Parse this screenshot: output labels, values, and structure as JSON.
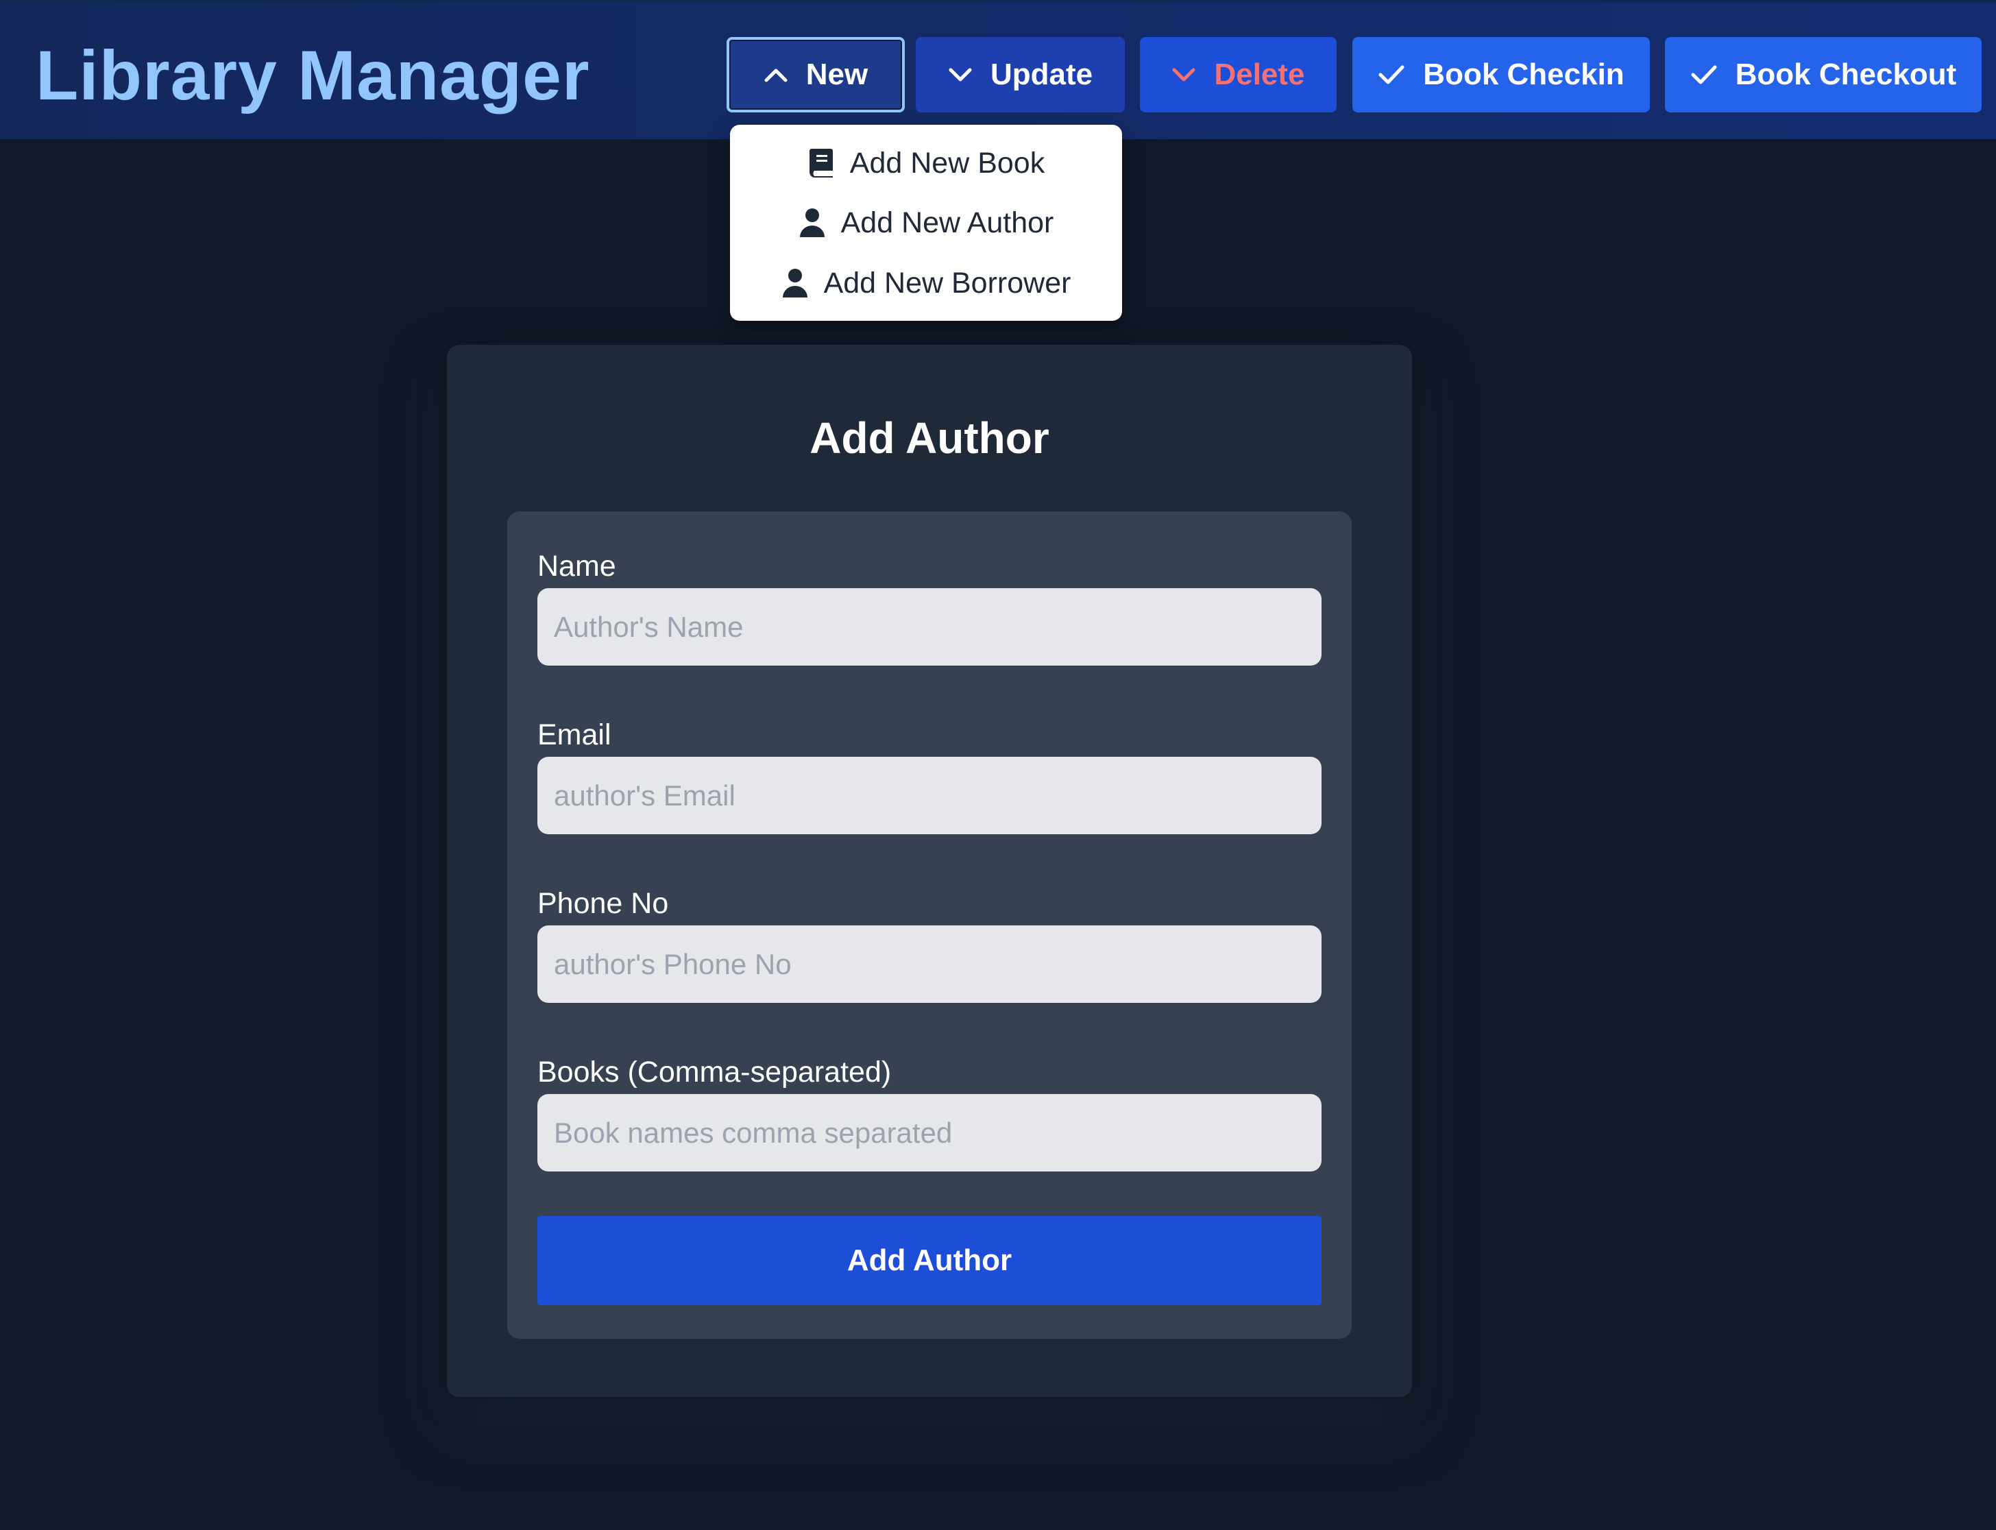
{
  "header": {
    "title": "Library Manager",
    "buttons": {
      "new": "New",
      "update": "Update",
      "delete": "Delete",
      "checkin": "Book Checkin",
      "checkout": "Book Checkout"
    }
  },
  "dropdown": {
    "items": [
      {
        "label": "Add New Book",
        "icon": "book-icon"
      },
      {
        "label": "Add New Author",
        "icon": "user-icon"
      },
      {
        "label": "Add New Borrower",
        "icon": "user-icon"
      }
    ]
  },
  "form": {
    "title": "Add Author",
    "fields": {
      "name": {
        "label": "Name",
        "placeholder": "Author's Name",
        "value": ""
      },
      "email": {
        "label": "Email",
        "placeholder": "author's Email",
        "value": ""
      },
      "phone": {
        "label": "Phone No",
        "placeholder": "author's Phone No",
        "value": ""
      },
      "books": {
        "label": "Books (Comma-separated)",
        "placeholder": "Book names comma separated",
        "value": ""
      }
    },
    "submit_label": "Add Author"
  },
  "colors": {
    "background": "#111827",
    "header": "#142a66",
    "title": "#93c5fd",
    "accent": "#2563eb",
    "danger_text": "#f87171",
    "card": "#1f2937",
    "panel": "#374151",
    "input": "#e5e7eb"
  }
}
